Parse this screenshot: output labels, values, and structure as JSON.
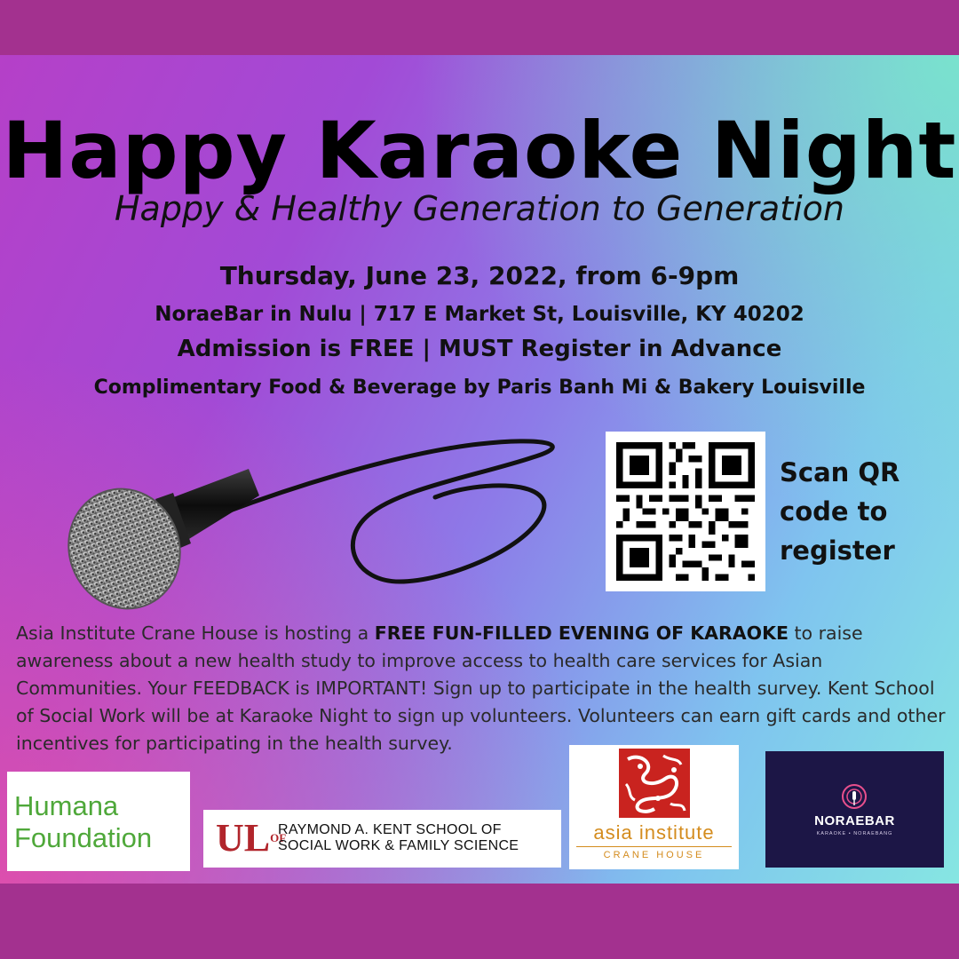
{
  "colors": {
    "band": "#a3318f",
    "humana_green": "#4fa83a",
    "ul_red": "#b1252b",
    "asia_gold": "#d48c1e",
    "norae_bg": "#1c1646"
  },
  "header": {
    "title": "Happy Karaoke Night",
    "subtitle": "Happy & Healthy Generation to Generation"
  },
  "details": {
    "date_time": "Thursday, June 23, 2022, from 6-9pm",
    "venue": "NoraeBar in Nulu | 717 E Market St, Louisville, KY 40202",
    "admission": "Admission is FREE | MUST Register in Advance",
    "food": "Complimentary Food & Beverage by Paris Banh Mi & Bakery Louisville"
  },
  "qr": {
    "icon": "qr-code-icon",
    "caption_lines": [
      "Scan QR",
      "code to",
      "register"
    ]
  },
  "illustration": {
    "icon": "microphone-icon"
  },
  "description": {
    "part1": "Asia Institute Crane House is hosting a ",
    "highlight": "FREE FUN-FILLED EVENING OF KARAOKE",
    "part2": " to raise awareness about a new health study to improve access to health care services for Asian Communities. Your FEEDBACK is IMPORTANT! Sign up to participate in the health survey. Kent School of Social Work will be at Karaoke Night to sign up volunteers. Volunteers can earn gift cards and other incentives for participating in the health survey."
  },
  "sponsors": {
    "humana": {
      "line1": "Humana",
      "line2": "Foundation"
    },
    "kent": {
      "mark": "UL",
      "mark_small": "OF",
      "line1": "RAYMOND A. KENT SCHOOL OF",
      "line2": "SOCIAL WORK & FAMILY SCIENCE"
    },
    "asia": {
      "name": "asia institute",
      "sub": "CRANE HOUSE"
    },
    "noraebar": {
      "name": "NORAEBAR",
      "sub": "KARAOKE • NORAEBANG"
    }
  }
}
